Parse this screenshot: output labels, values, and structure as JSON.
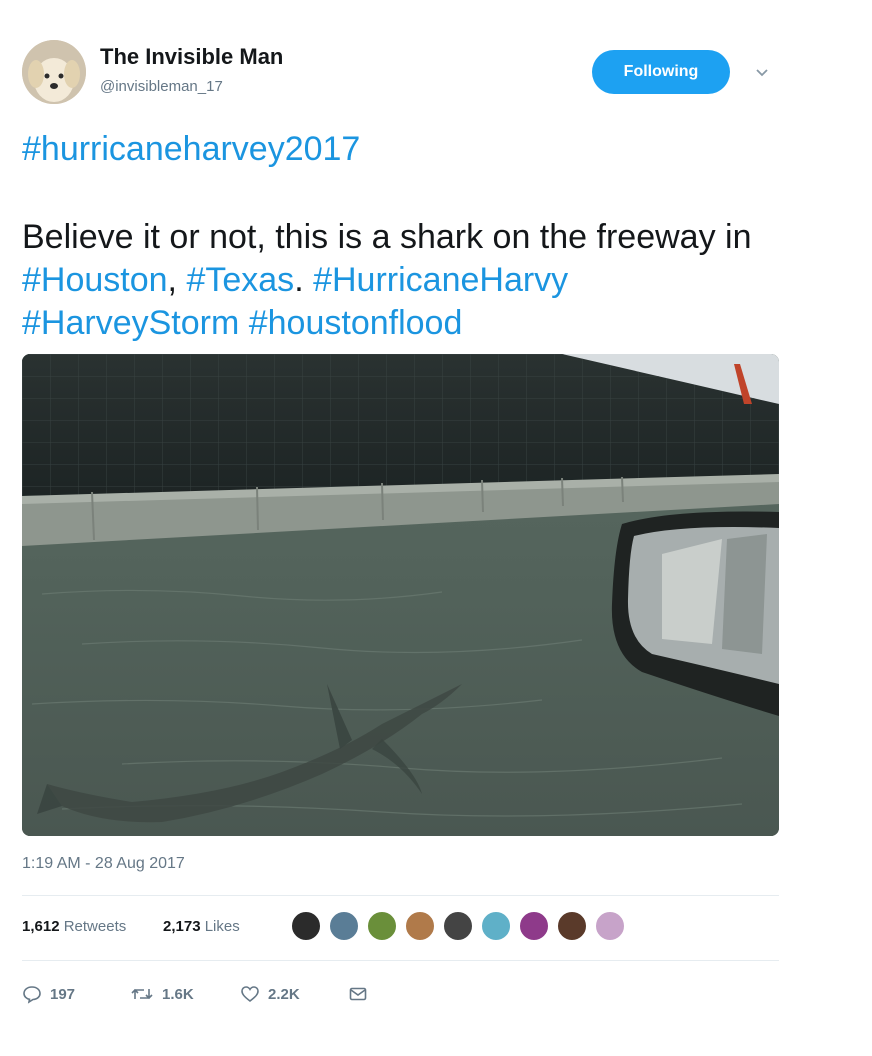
{
  "author": {
    "name": "The Invisible Man",
    "handle": "@invisibleman_17"
  },
  "follow_button_label": "Following",
  "tweet": {
    "hashtag_line": "#hurricaneharvey2017",
    "text_plain_1": "Believe it or not, this is a shark on the freeway in ",
    "tag_houston": "#Houston",
    "comma": ", ",
    "tag_texas": "#Texas",
    "dot": ". ",
    "tag_harvy": "#HurricaneHarvy",
    "tag_storm": "#HarveyStorm",
    "tag_flood": "#houstonflood"
  },
  "timestamp": "1:19 AM - 28 Aug 2017",
  "stats": {
    "retweets_count": "1,612",
    "retweets_label": "Retweets",
    "likes_count": "2,173",
    "likes_label": "Likes"
  },
  "actions": {
    "replies": "197",
    "retweets": "1.6K",
    "likes": "2.2K"
  },
  "colors": {
    "accent": "#1da1f2",
    "link": "#1b95e0",
    "muted": "#657786"
  }
}
